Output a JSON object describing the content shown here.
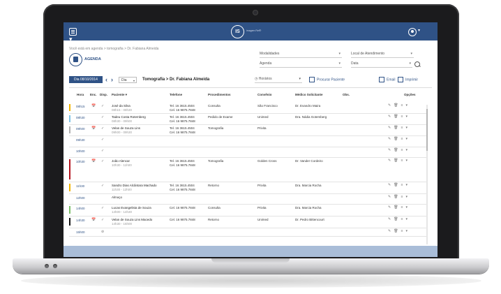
{
  "header": {
    "logo_label": "IS",
    "logo_caption": "imagem Rel®"
  },
  "breadcrumb": "Você está em agenda > tomografia > Dr. Fabiana Almeida",
  "page_title": "AGENDA",
  "filters": {
    "modalidades": "Modalidades",
    "local": "Local de Atendimento",
    "agenda": "Agenda",
    "data": "Data"
  },
  "toolbar": {
    "day_label": "Dia 08/10/2014",
    "view": "Dia",
    "title": "Tomografia > Dr. Fabiana Almeida",
    "horarios": "Horários",
    "procurar": "Procurar Paciente",
    "email": "Email",
    "imprimir": "Imprimir"
  },
  "columns": [
    "Hora",
    "Enc.",
    "Disp.",
    "Paciente ▾",
    "Telefone",
    "Procedimentos",
    "Convênio",
    "Médico Solicitante",
    "Obs.",
    "Opções"
  ],
  "rows": [
    {
      "time": "08h15",
      "enc": "📅",
      "disp": "✓",
      "name": "José da Silva",
      "sub": "08h15 - 08h30",
      "tel1": "Tel. 16 3615.4504",
      "tel2": "Cel. 16 9875.7848",
      "proc": "Consulta",
      "conv": "São Francisco",
      "med": "Dr. Evandro Maira",
      "color": "#f0b400"
    },
    {
      "time": "08h30",
      "enc": "",
      "disp": "✓",
      "name": "Tadeu Costa Rotemberg",
      "sub": "08h30 - 09h00",
      "tel1": "Tel. 16 3615.4504",
      "tel2": "Cel. 16 9875.7848",
      "proc": "Pedido de Exame",
      "conv": "Unimed",
      "med": "Dra. Nádia Gotemberg",
      "color": "#7fc3e6"
    },
    {
      "time": "09h00",
      "enc": "📅",
      "disp": "✓",
      "name": "Velan de Souza Lins",
      "sub": "09h00 - 09h30",
      "tel1": "Tel. 16 3615.4504",
      "tel2": "Cel. 16 9875.7848",
      "proc": "Tomografia",
      "conv": "Privita",
      "med": "",
      "color": "#b0b0b0"
    },
    {
      "time": "09h30",
      "enc": "",
      "disp": "✓",
      "name": "",
      "sub": "",
      "tel1": "",
      "tel2": "",
      "proc": "",
      "conv": "",
      "med": "",
      "color": ""
    },
    {
      "time": "10h00",
      "enc": "",
      "disp": "✓",
      "name": "",
      "sub": "",
      "tel1": "",
      "tel2": "",
      "proc": "",
      "conv": "",
      "med": "",
      "color": ""
    },
    {
      "time": "10h30",
      "enc": "📅",
      "disp": "✓",
      "name": "João Alencar",
      "sub": "10h30 - 11h00",
      "tel1": "Tel. 16 3615.4504",
      "tel2": "Cel. 16 9875.7848",
      "proc": "Tomografia",
      "conv": "Golden Cross",
      "med": "Dr. Vander Cordeiro",
      "color": "#b4141e"
    },
    {
      "time": "11h30",
      "enc": "",
      "disp": "✓",
      "name": "Sandro Dias Alcântara Machado",
      "sub": "11h30 - 12h00",
      "tel1": "Tel. 16 3615.4504",
      "tel2": "Cel. 16 9875.7848",
      "proc": "Retorno",
      "conv": "Privita",
      "med": "Dra. Marcia Rocha",
      "color": "#f0b400"
    },
    {
      "time": "12h00",
      "enc": "",
      "disp": "",
      "name": "Almoço",
      "sub": "",
      "tel1": "",
      "tel2": "",
      "proc": "",
      "conv": "",
      "med": "",
      "color": ""
    },
    {
      "time": "14h00",
      "enc": "",
      "disp": "✓",
      "name": "Lucas Evangelista de Souza",
      "sub": "14h00 - 14h30",
      "tel1": "Cel. 16 9875.7848",
      "tel2": "",
      "proc": "Consulta",
      "conv": "Privita",
      "med": "Dra. Marcia Rocha",
      "color": "#7cbf6a"
    },
    {
      "time": "14h30",
      "enc": "📅",
      "disp": "✓",
      "name": "Velan de Souza Lins Macedo",
      "sub": "14h30 - 15h00",
      "tel1": "Cel. 16 9875.7848",
      "tel2": "",
      "proc": "Retorno",
      "conv": "Unimed",
      "med": "Dr. Pedro Bittencourt",
      "color": "#111111"
    },
    {
      "time": "15h00",
      "enc": "",
      "disp": "⊘",
      "name": "",
      "sub": "",
      "tel1": "",
      "tel2": "",
      "proc": "",
      "conv": "",
      "med": "",
      "color": ""
    }
  ]
}
